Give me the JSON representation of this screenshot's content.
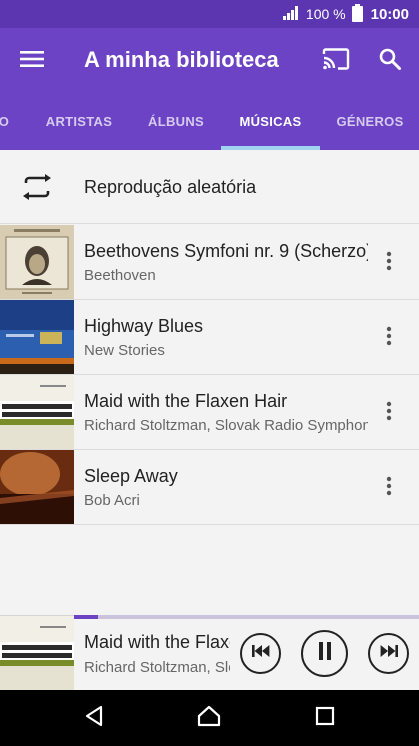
{
  "status_bar": {
    "battery_percent": "100 %",
    "time": "10:00",
    "icons": [
      "signal-icon",
      "battery-icon"
    ]
  },
  "app_bar": {
    "title": "A minha biblioteca",
    "icons": [
      "menu-icon",
      "cast-icon",
      "search-icon"
    ]
  },
  "tabs": [
    {
      "label": "O",
      "active": false
    },
    {
      "label": "ARTISTAS",
      "active": false
    },
    {
      "label": "ÁLBUNS",
      "active": false
    },
    {
      "label": "MÚSICAS",
      "active": true
    },
    {
      "label": "GÉNEROS",
      "active": false
    }
  ],
  "shuffle": {
    "label": "Reprodução aleatória",
    "icon": "shuffle-icon"
  },
  "songs": [
    {
      "title": "Beethovens Symfoni nr. 9 (Scherzo)",
      "artist": "Beethoven"
    },
    {
      "title": "Highway Blues",
      "artist": "New Stories"
    },
    {
      "title": "Maid with the Flaxen Hair",
      "artist": "Richard Stoltzman, Slovak Radio Symphony Orchestra"
    },
    {
      "title": "Sleep Away",
      "artist": "Bob Acri"
    }
  ],
  "now_playing": {
    "title": "Maid with the Flaxen Hair",
    "artist": "Richard Stoltzman, Slovak Radio Symphony Orchestra",
    "progress": 0.07
  },
  "nav_bar": {
    "icons": [
      "back-icon",
      "home-icon",
      "recents-icon"
    ]
  },
  "colors": {
    "status_bar": "#5c35b0",
    "app_bar": "#6b43c4",
    "tab_indicator": "#9fd3f0",
    "background": "#f3f3f3"
  }
}
